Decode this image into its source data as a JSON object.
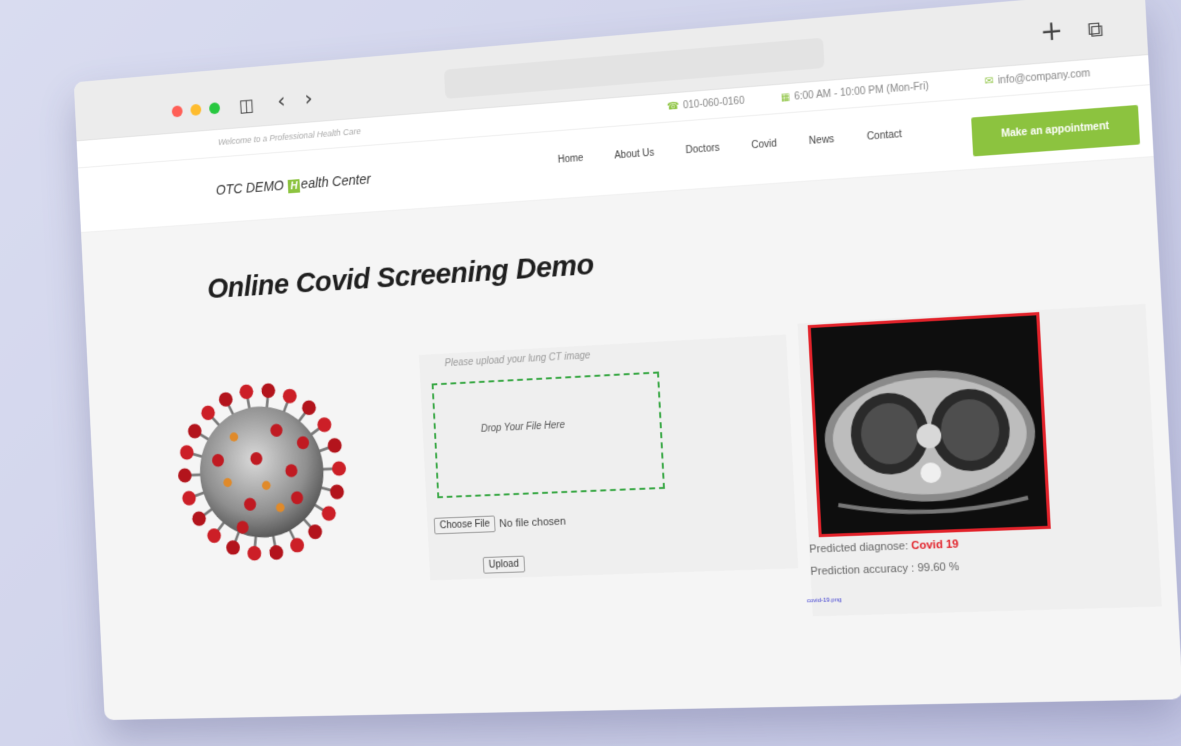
{
  "browser": {
    "new_tab_icon": "plus-icon",
    "windows_icon": "copy-window-icon"
  },
  "topbar": {
    "welcome": "Welcome to a Professional Health Care",
    "phone": "010-060-0160",
    "hours": "6:00 AM - 10:00 PM (Mon-Fri)",
    "email": "info@company.com"
  },
  "header": {
    "logo_prefix": "OTC DEMO",
    "logo_letter": "H",
    "logo_suffix": "ealth Center",
    "nav": [
      "Home",
      "About Us",
      "Doctors",
      "Covid",
      "News",
      "Contact"
    ],
    "cta": "Make an appointment"
  },
  "main": {
    "title": "Online Covid Screening Demo",
    "upload_prompt": "Please upload your lung CT image",
    "dropzone_text": "Drop Your File Here",
    "choose_file": "Choose File",
    "no_file": "No file chosen",
    "upload": "Upload",
    "diagnosis_label": "Predicted diagnose:",
    "diagnosis_value": "Covid 19",
    "accuracy_label": "Prediction accuracy :",
    "accuracy_value": "99.60 %",
    "filename": "covid-19.png"
  },
  "colors": {
    "accent": "#8cc33f",
    "alert": "#e2222a",
    "dropzone_border": "#39a845"
  }
}
